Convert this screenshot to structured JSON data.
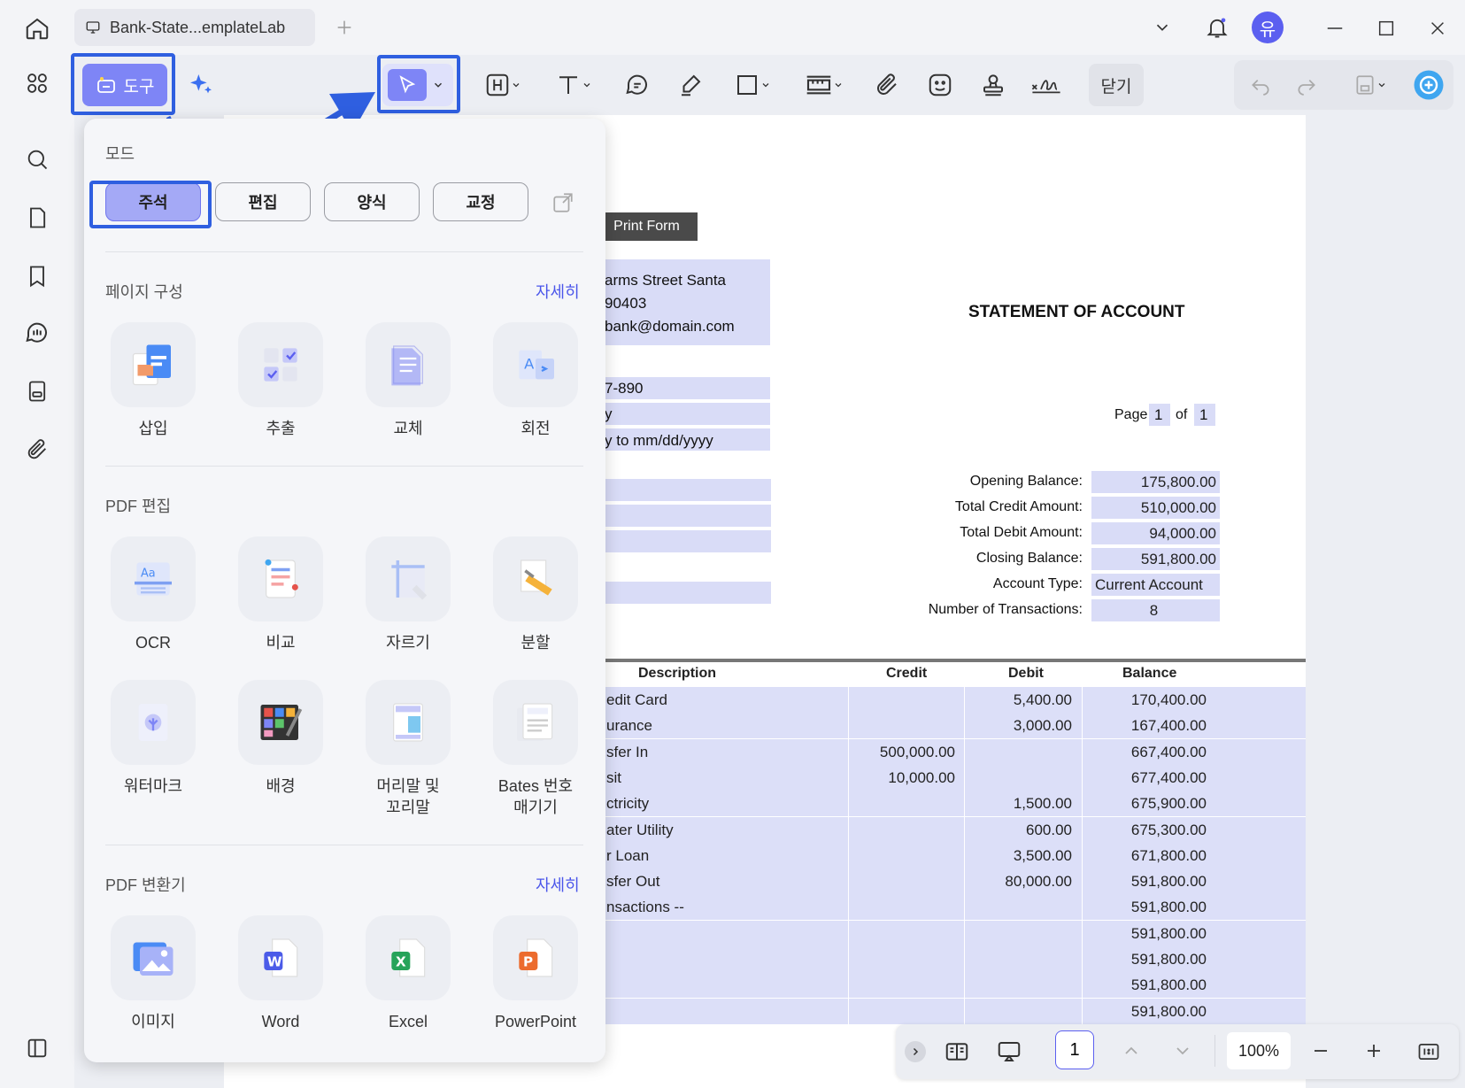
{
  "window": {
    "tab_title": "Bank-State...emplateLab",
    "avatar_letter": "유"
  },
  "toolbar": {
    "tools_label": "도구",
    "close_label": "닫기"
  },
  "panel": {
    "mode_title": "모드",
    "modes": [
      "주석",
      "편집",
      "양식",
      "교정"
    ],
    "page_section": "페이지 구성",
    "page_more": "자세히",
    "page_tools": [
      "삽입",
      "추출",
      "교체",
      "회전"
    ],
    "edit_section": "PDF 편집",
    "edit_tools": [
      "OCR",
      "비교",
      "자르기",
      "분할",
      "워터마크",
      "배경",
      "머리말 및\n꼬리말",
      "Bates 번호\n매기기"
    ],
    "convert_section": "PDF 변환기",
    "convert_more": "자세히",
    "convert_tools": [
      "이미지",
      "Word",
      "Excel",
      "PowerPoint"
    ]
  },
  "document": {
    "print_form": "Print Form",
    "address": [
      "arms Street Santa",
      "90403",
      "bank@domain.com"
    ],
    "account_lines": [
      "7-890",
      "y",
      "y to mm/dd/yyyy"
    ],
    "title": "STATEMENT OF ACCOUNT",
    "page_label": "Page",
    "page_num": "1",
    "of_label": "of",
    "page_total": "1",
    "summary": [
      {
        "label": "Opening Balance:",
        "value": "175,800.00"
      },
      {
        "label": "Total Credit Amount:",
        "value": "510,000.00"
      },
      {
        "label": "Total Debit Amount:",
        "value": "94,000.00"
      },
      {
        "label": "Closing Balance:",
        "value": "591,800.00"
      },
      {
        "label": "Account Type:",
        "value": "Current Account"
      },
      {
        "label": "Number of Transactions:",
        "value": "8"
      }
    ],
    "headers": [
      "Description",
      "Credit",
      "Debit",
      "Balance"
    ],
    "rows": [
      [
        "edit Card",
        "",
        "5,400.00",
        "170,400.00"
      ],
      [
        "urance",
        "",
        "3,000.00",
        "167,400.00"
      ],
      [
        "sfer In",
        "500,000.00",
        "",
        "667,400.00"
      ],
      [
        "sit",
        "10,000.00",
        "",
        "677,400.00"
      ],
      [
        "ctricity",
        "",
        "1,500.00",
        "675,900.00"
      ],
      [
        "ater Utility",
        "",
        "600.00",
        "675,300.00"
      ],
      [
        "r Loan",
        "",
        "3,500.00",
        "671,800.00"
      ],
      [
        "sfer Out",
        "",
        "80,000.00",
        "591,800.00"
      ],
      [
        "nsactions --",
        "",
        "",
        "591,800.00"
      ],
      [
        "",
        "",
        "",
        "591,800.00"
      ],
      [
        "",
        "",
        "",
        "591,800.00"
      ],
      [
        "",
        "",
        "",
        "591,800.00"
      ],
      [
        "",
        "",
        "",
        "591,800.00"
      ]
    ]
  },
  "bottombar": {
    "page_input": "1",
    "zoom": "100%"
  },
  "colors": {
    "accent": "#7e85f6",
    "highlight": "#2f5fe0",
    "field": "#d9dcf7"
  }
}
